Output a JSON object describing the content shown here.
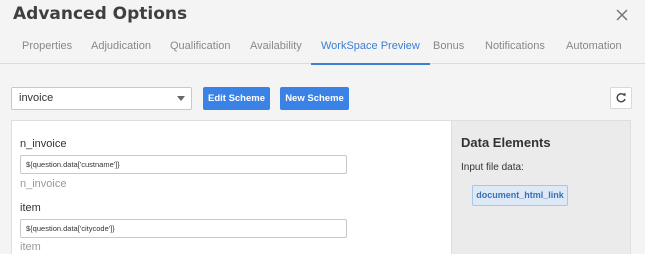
{
  "header": {
    "title": "Advanced Options"
  },
  "tabs": [
    {
      "label": "Properties"
    },
    {
      "label": "Adjudication"
    },
    {
      "label": "Qualification"
    },
    {
      "label": "Availability"
    },
    {
      "label": "WorkSpace Preview",
      "active": true
    },
    {
      "label": "Bonus"
    },
    {
      "label": "Notifications"
    },
    {
      "label": "Automation"
    }
  ],
  "toolbar": {
    "scheme_select": {
      "value": "invoice"
    },
    "edit_scheme_label": "Edit Scheme",
    "new_scheme_label": "New Scheme",
    "refresh_icon": "refresh-icon"
  },
  "fields": [
    {
      "label": "n_invoice",
      "value": "${question.data['custname']}",
      "sublabel": "n_invoice"
    },
    {
      "label": "item",
      "value": "${question.data['citycode']}",
      "sublabel": "item"
    }
  ],
  "data_elements": {
    "title": "Data Elements",
    "subtitle": "Input file data:",
    "items": [
      "document_html_link"
    ]
  },
  "colors": {
    "accent": "#3b82e6",
    "active_tab": "#3b7fd6"
  }
}
